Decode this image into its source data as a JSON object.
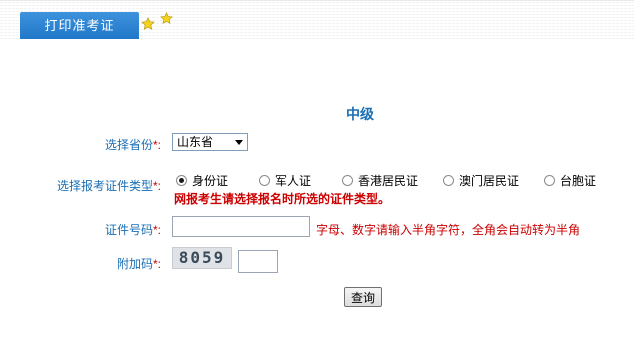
{
  "header": {
    "tab_label": "打印准考证"
  },
  "form": {
    "title": "中级",
    "province": {
      "label": "选择省份",
      "required_mark": "*:",
      "selected": "山东省"
    },
    "id_type": {
      "label": "选择报考证件类型",
      "required_mark": "*:",
      "options": [
        "身份证",
        "军人证",
        "香港居民证",
        "澳门居民证",
        "台胞证"
      ],
      "selected_index": 0,
      "warning": "网报考生请选择报名时所选的证件类型。"
    },
    "id_number": {
      "label": "证件号码",
      "required_mark": "*:",
      "value": "",
      "hint": "字母、数字请输入半角字符，全角会自动转为半角"
    },
    "captcha": {
      "label": "附加码",
      "required_mark": "*:",
      "image_text": "8059",
      "value": ""
    },
    "submit_label": "查询"
  },
  "colors": {
    "accent": "#1a6fb4",
    "tab_bg": "#2c84d2",
    "warning": "#cc0000"
  },
  "icons": [
    "star-icon",
    "star-icon"
  ]
}
